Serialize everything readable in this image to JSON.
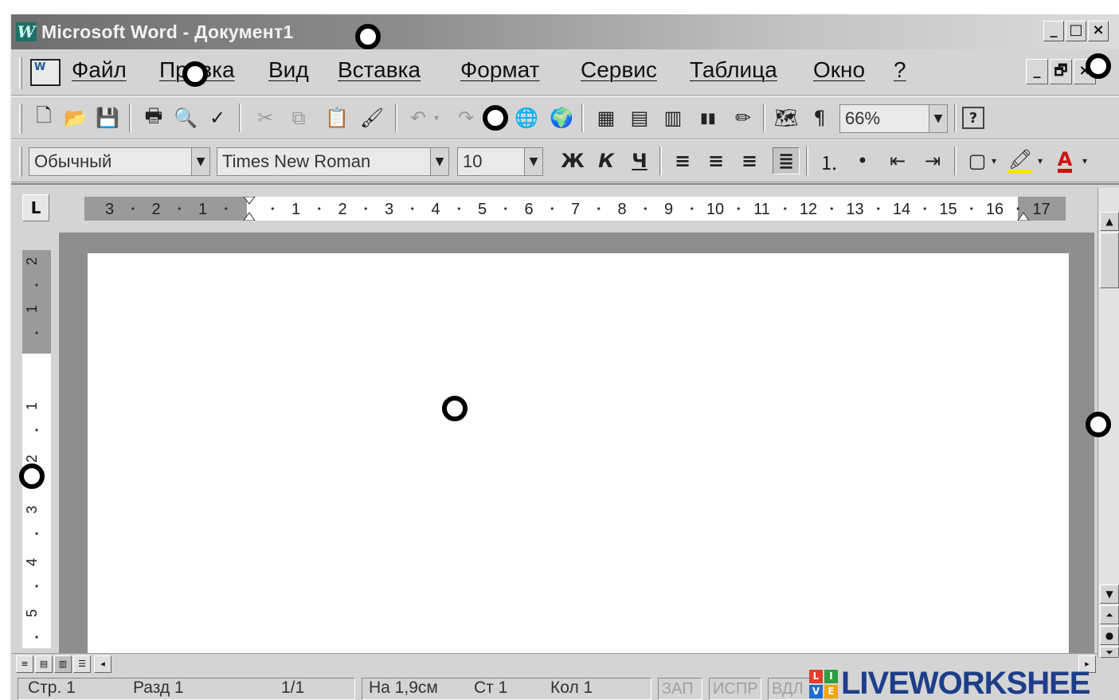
{
  "window": {
    "title": "Microsoft Word - Документ1",
    "app_icon_glyph": "W",
    "buttons": {
      "minimize": "_",
      "maximize": "□",
      "close": "×"
    }
  },
  "menubar": {
    "doc_icon_label": "W",
    "items": [
      {
        "label": "Файл"
      },
      {
        "label": "Правка"
      },
      {
        "label": "Вид"
      },
      {
        "label": "Вставка"
      },
      {
        "label": "Формат"
      },
      {
        "label": "Сервис"
      },
      {
        "label": "Таблица"
      },
      {
        "label": "Окно"
      },
      {
        "label": "?"
      }
    ],
    "doc_buttons": {
      "minimize": "_",
      "restore": "🗗",
      "close": "×"
    }
  },
  "standard_toolbar": {
    "icons": {
      "new": "🗋",
      "open": "📂",
      "save": "💾",
      "print": "🖶",
      "preview": "🔍",
      "spelling": "✓",
      "cut": "✂",
      "copy": "⧉",
      "paste": "📋",
      "format_painter": "🖌",
      "undo": "↶",
      "redo": "↷",
      "hyperlink": "🌐",
      "web_toolbar": "🌍",
      "tables_borders": "▦",
      "insert_table": "▤",
      "insert_excel": "▥",
      "columns": "▮▮",
      "drawing": "✏",
      "doc_map": "🗺",
      "show_marks": "¶",
      "help": "?"
    },
    "zoom": "66%"
  },
  "formatting_toolbar": {
    "style": "Обычный",
    "font": "Times New Roman",
    "size": "10",
    "bold": "Ж",
    "italic": "К",
    "underline": "Ч",
    "icons": {
      "align_left": "≡",
      "align_center": "≡",
      "align_right": "≡",
      "justify": "≣",
      "numbered_list": "⒈",
      "bulleted_list": "•",
      "decrease_indent": "⇤",
      "increase_indent": "⇥",
      "borders": "▢",
      "highlight": "🖍",
      "font_color": "A"
    },
    "highlight_color": "#f2e600",
    "font_color_value": "#d01010"
  },
  "horizontal_ruler": {
    "tab_selector": "L",
    "negative_ticks": [
      "3",
      "2",
      "1"
    ],
    "ticks": [
      "1",
      "2",
      "3",
      "4",
      "5",
      "6",
      "7",
      "8",
      "9",
      "10",
      "11",
      "12",
      "13",
      "14",
      "15",
      "16",
      "17"
    ]
  },
  "vertical_ruler": {
    "ticks": [
      "2",
      "1",
      "1",
      "2",
      "3",
      "4",
      "5"
    ]
  },
  "statusbar": {
    "page": "Стр. 1",
    "section": "Разд 1",
    "pages": "1/1",
    "position": "На 1,9см",
    "line": "Ст 1",
    "column": "Кол 1",
    "indicators": [
      "ЗАП",
      "ИСПР",
      "ВДЛ"
    ]
  },
  "watermark": {
    "logo_letters": [
      "L",
      "I",
      "V",
      "E"
    ],
    "text": "LIVEWORKSHEE"
  }
}
